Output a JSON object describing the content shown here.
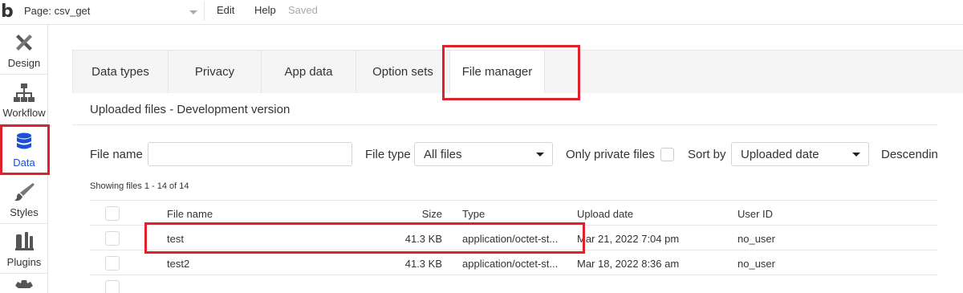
{
  "topbar": {
    "logo": "b",
    "page_label": "Page: csv_get",
    "menu": {
      "edit": "Edit",
      "help": "Help",
      "saved": "Saved"
    }
  },
  "sidebar": {
    "items": [
      {
        "label": "Design",
        "icon": "design-icon"
      },
      {
        "label": "Workflow",
        "icon": "workflow-icon"
      },
      {
        "label": "Data",
        "icon": "database-icon"
      },
      {
        "label": "Styles",
        "icon": "brush-icon"
      },
      {
        "label": "Plugins",
        "icon": "plug-icon"
      }
    ]
  },
  "tabs": [
    {
      "label": "Data types"
    },
    {
      "label": "Privacy"
    },
    {
      "label": "App data"
    },
    {
      "label": "Option sets"
    },
    {
      "label": "File manager"
    }
  ],
  "file_manager": {
    "subtitle": "Uploaded files - Development version",
    "filters": {
      "file_name_label": "File name",
      "file_name_value": "",
      "file_type_label": "File type",
      "file_type_value": "All files",
      "private_label": "Only private files",
      "sort_by_label": "Sort by",
      "sort_by_value": "Uploaded date",
      "descending_label": "Descendin"
    },
    "showing": "Showing files 1 - 14 of 14",
    "columns": {
      "file_name": "File name",
      "size": "Size",
      "type": "Type",
      "upload_date": "Upload date",
      "user_id": "User ID"
    },
    "rows": [
      {
        "name": "test",
        "size": "41.3 KB",
        "type": "application/octet-st...",
        "date": "Mar 21, 2022 7:04 pm",
        "user": "no_user"
      },
      {
        "name": "test2",
        "size": "41.3 KB",
        "type": "application/octet-st...",
        "date": "Mar 18, 2022 8:36 am",
        "user": "no_user"
      }
    ]
  },
  "colors": {
    "highlight": "#e0202a",
    "active_blue": "#1a4fd6"
  }
}
